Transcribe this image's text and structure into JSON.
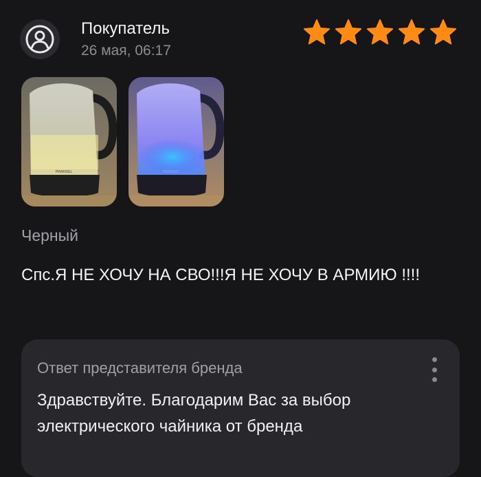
{
  "review": {
    "author": "Покупатель",
    "date": "26 мая, 06:17",
    "rating": 5,
    "max_rating": 5,
    "variant": "Черный",
    "text": "Спс.Я НЕ ХОЧУ НА СВО!!!Я НЕ ХОЧУ В АРМИЮ !!!!",
    "photos": [
      {
        "icon": "kettle-photo-daylight"
      },
      {
        "icon": "kettle-photo-blue-backlight"
      }
    ]
  },
  "brand_reply": {
    "title": "Ответ представителя бренда",
    "text": "Здравствуйте. Благодарим Вас за выбор электрического чайника от бренда"
  },
  "colors": {
    "background": "#161518",
    "star": "#ff8a14",
    "card": "#28272c",
    "muted_text": "#8d8c92",
    "avatar_bg": "#2b2a2f"
  },
  "icons": {
    "avatar": "user-avatar-icon",
    "star": "star-icon",
    "menu": "more-vertical-icon"
  }
}
